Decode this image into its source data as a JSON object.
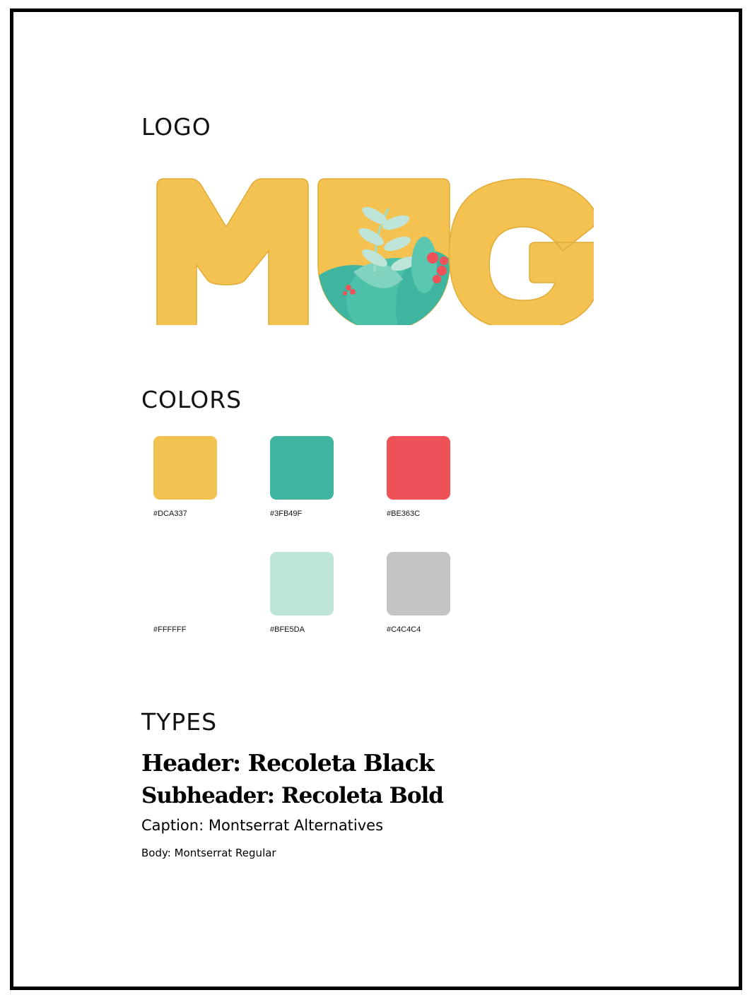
{
  "sections": {
    "logo_title": "LOGO",
    "colors_title": "COLORS",
    "types_title": "TYPES"
  },
  "logo": {
    "letters": [
      "M",
      "U",
      "G"
    ],
    "colors": {
      "letter": "#F3C251",
      "leaf_dark": "#3FB49F",
      "leaf_light": "#BFE5DA",
      "berry": "#EF5159"
    }
  },
  "colors": [
    {
      "hex": "#DCA337",
      "display": "#F3C251"
    },
    {
      "hex": "#3FB49F",
      "display": "#3FB49F"
    },
    {
      "hex": "#BE363C",
      "display": "#EF5159"
    },
    {
      "hex": "#FFFFFF",
      "display": "#FFFFFF"
    },
    {
      "hex": "#BFE5DA",
      "display": "#BFE5DA"
    },
    {
      "hex": "#C4C4C4",
      "display": "#C4C4C4"
    }
  ],
  "types": {
    "header": "Header: Recoleta Black",
    "subheader": "Subheader: Recoleta Bold",
    "caption": "Caption: Montserrat Alternatives",
    "body": "Body: Montserrat Regular"
  }
}
